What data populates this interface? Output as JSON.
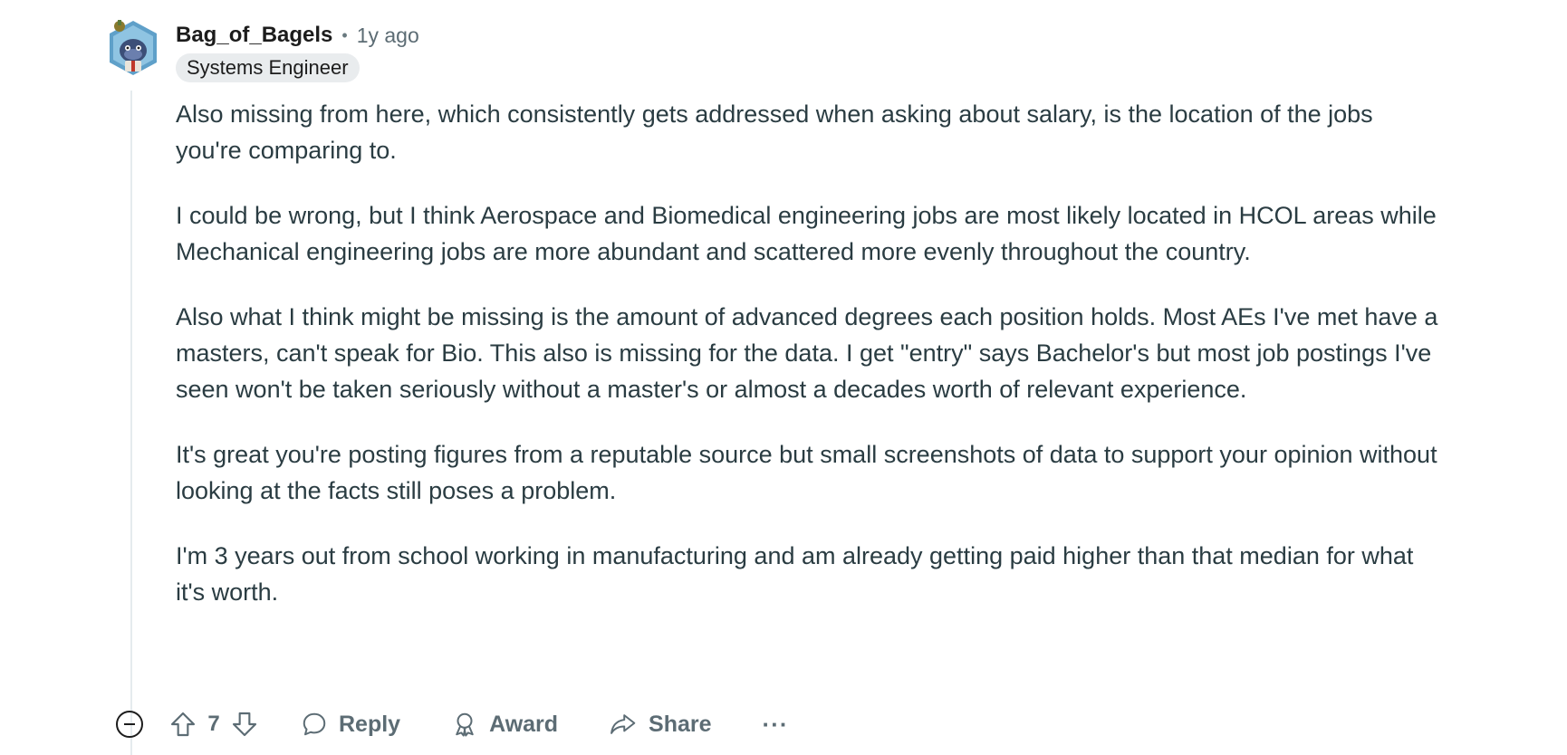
{
  "comment": {
    "author": "Bag_of_Bagels",
    "separator": "•",
    "time": "1y ago",
    "flair": "Systems Engineer",
    "paragraphs": [
      "Also missing from here, which consistently gets addressed when asking about salary, is the location of the jobs you're comparing to.",
      "I could be wrong, but I think Aerospace and Biomedical engineering jobs are most likely located in HCOL areas while Mechanical engineering jobs are more abundant and scattered more evenly throughout the country.",
      "Also what I think might be missing is the amount of advanced degrees each position holds. Most AEs I've met have a masters, can't speak for Bio. This also is missing for the data. I get \"entry\" says Bachelor's but most job postings I've seen won't be taken seriously without a master's or almost a decades worth of relevant experience.",
      "It's great you're posting figures from a reputable source but small screenshots of data to support your opinion without looking at the facts still poses a problem.",
      "I'm 3 years out from school working in manufacturing and am already getting paid higher than that median for what it's worth."
    ]
  },
  "actions": {
    "vote_count": "7",
    "reply_label": "Reply",
    "award_label": "Award",
    "share_label": "Share",
    "more_label": "···"
  },
  "icons": {
    "collapse": "minus-circle-icon",
    "upvote": "arrow-up-icon",
    "downvote": "arrow-down-icon",
    "reply": "speech-bubble-icon",
    "award": "award-ribbon-icon",
    "share": "share-arrow-icon"
  },
  "colors": {
    "text": "#2a3c42",
    "muted": "#5c6c74",
    "flair_bg": "#e9ecee",
    "thread_line": "#e5ebee"
  }
}
